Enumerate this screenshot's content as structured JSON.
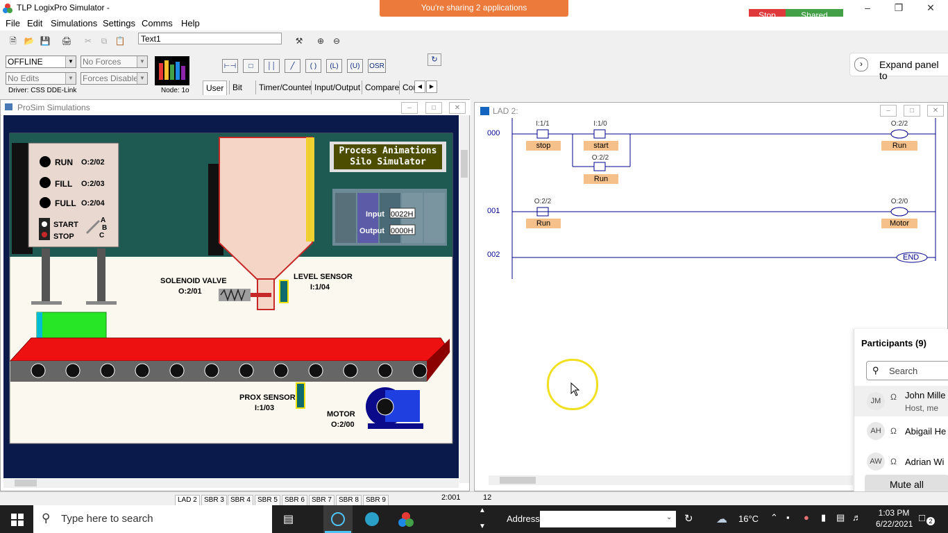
{
  "app": {
    "title": "TLP LogixPro Simulator",
    "title_suffix": "-",
    "share_banner": "You're sharing 2 applications",
    "stop_label": "Stop",
    "shared_label": "Shared"
  },
  "menu": [
    "File",
    "Edit",
    "Simulations",
    "Settings",
    "Comms",
    "Help"
  ],
  "toolbar": {
    "text_value": "Text1",
    "mode": "OFFLINE",
    "forces": "No Forces",
    "edits": "No Edits",
    "forces_enabled": "Forces Disabled",
    "driver": "Driver: CSS DDE-Link",
    "node": "Node: 1o",
    "osr": "OSR",
    "tabs": [
      "User",
      "Bit",
      "Timer/Counter",
      "Input/Output",
      "Compare",
      "Con"
    ],
    "expand_panel": "Expand panel to"
  },
  "prosim": {
    "title": "ProSim Simulations",
    "banner_line1": "Process Animations",
    "banner_line2": "Silo Simulator",
    "panel": {
      "run": "RUN",
      "run_addr": "O:2/02",
      "fill": "FILL",
      "fill_addr": "O:2/03",
      "full": "FULL",
      "full_addr": "O:2/04",
      "start": "START",
      "stop": "STOP",
      "abc_a": "A",
      "abc_b": "B",
      "abc_c": "C"
    },
    "plc": {
      "input_label": "Input",
      "input_value": "0022H",
      "output_label": "Output",
      "output_value": "0000H"
    },
    "solenoid": {
      "name": "SOLENOID VALVE",
      "addr": "O:2/01"
    },
    "level_sensor": {
      "name": "LEVEL SENSOR",
      "addr": "I:1/04"
    },
    "prox_sensor": {
      "name": "PROX SENSOR",
      "addr": "I:1/03"
    },
    "motor": {
      "name": "MOTOR",
      "addr": "O:2/00"
    }
  },
  "lad": {
    "title": "LAD 2:",
    "rungs": [
      {
        "num": "000",
        "contacts": [
          {
            "addr": "I:1/1",
            "tag": "stop"
          },
          {
            "addr": "I:1/0",
            "tag": "start"
          },
          {
            "addr": "O:2/2",
            "tag": "Run"
          }
        ],
        "coil": {
          "addr": "O:2/2",
          "tag": "Run"
        }
      },
      {
        "num": "001",
        "contacts": [
          {
            "addr": "O:2/2",
            "tag": "Run"
          }
        ],
        "coil": {
          "addr": "O:2/0",
          "tag": "Motor"
        }
      },
      {
        "num": "002",
        "end": "END"
      }
    ]
  },
  "participants": {
    "title": "Participants (9)",
    "search_placeholder": "Search",
    "list": [
      {
        "initials": "JM",
        "name": "John Mille",
        "role": "Host, me"
      },
      {
        "initials": "AH",
        "name": "Abigail He"
      },
      {
        "initials": "AW",
        "name": "Adrian Wi"
      }
    ],
    "mute_all": "Mute all"
  },
  "statusbar": {
    "tabs": [
      "LAD 2",
      "SBR 3",
      "SBR 4",
      "SBR 5",
      "SBR 6",
      "SBR 7",
      "SBR 8",
      "SBR 9"
    ],
    "addr": "2:001",
    "count": "12"
  },
  "taskbar": {
    "search_placeholder": "Type here to search",
    "address_label": "Address",
    "temperature": "16°C",
    "time": "1:03 PM",
    "date": "6/22/2021",
    "notifications": "2"
  },
  "colors": {
    "accent_orange": "#ec7a3b",
    "stop_red": "#e0393b",
    "shared_green": "#43a047",
    "ladder_blue": "#00008b",
    "tag_orange": "#f5c08a"
  }
}
